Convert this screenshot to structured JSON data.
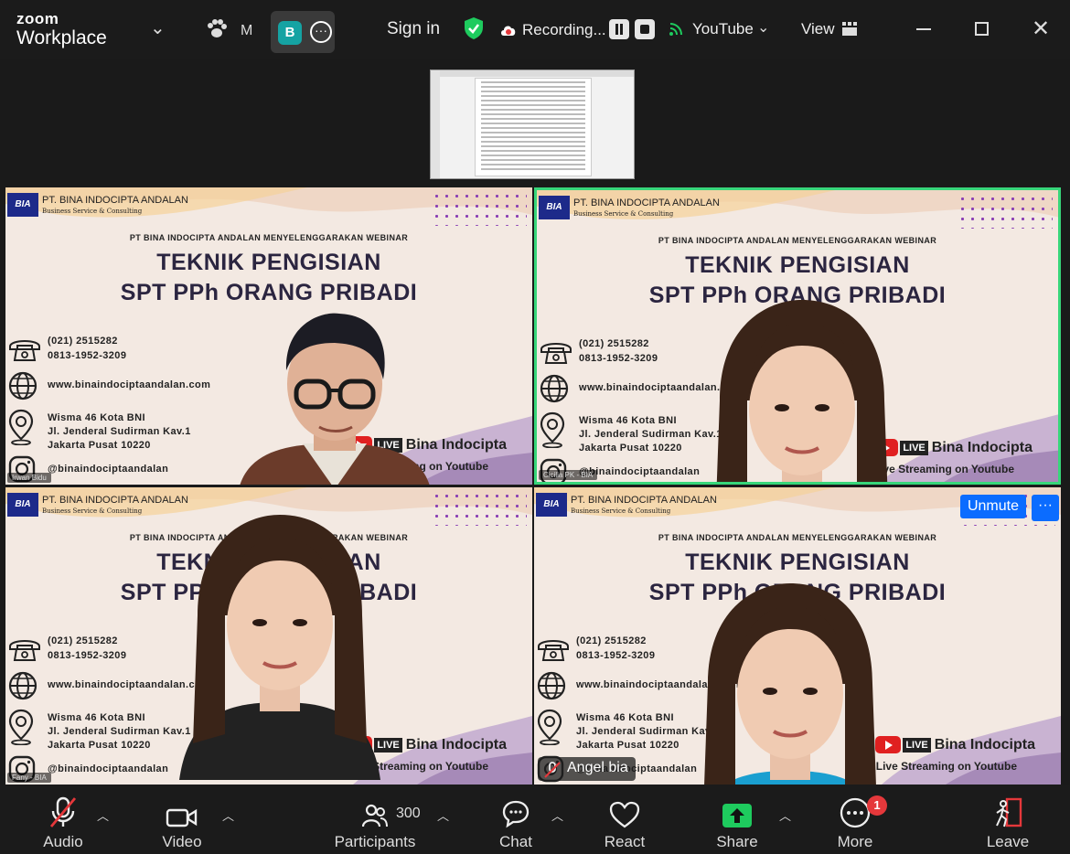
{
  "app": {
    "brand_top": "zoom",
    "brand_bottom": "Workplace"
  },
  "topbar": {
    "meeting_abbrev": "M",
    "avatar_letter": "B",
    "sign_in": "Sign in",
    "recording": "Recording...",
    "youtube": "YouTube",
    "view": "View"
  },
  "tiles": [
    {
      "company": "PT. BINA INDOCIPTA ANDALAN",
      "company_sub": "Business Service & Consulting",
      "logo": "BIA",
      "eyebrow": "PT BINA INDOCIPTA ANDALAN  MENYELENGGARAKAN WEBINAR",
      "title1": "TEKNIK PENGISIAN",
      "title2": "SPT PPh ORANG PRIBADI",
      "phone1": "(021) 2515282",
      "phone2": "0813-1952-3209",
      "web": "www.binaindociptaandalan.com",
      "addr1": "Wisma 46 Kota BNI",
      "addr2": "Jl. Jenderal Sudirman Kav.1",
      "addr3": "Jakarta Pusat 10220",
      "ig": "@binaindociptaandalan",
      "live_badge": "LIVE",
      "live_name": "Bina Indocipta",
      "live_sub": "Live Streaming on Youtube",
      "name": "Irwan Bidu"
    },
    {
      "company": "PT. BINA INDOCIPTA ANDALAN",
      "company_sub": "Business Service & Consulting",
      "logo": "BIA",
      "eyebrow": "PT BINA INDOCIPTA ANDALAN  MENYELENGGARAKAN WEBINAR",
      "title1": "TEKNIK PENGISIAN",
      "title2": "SPT PPh ORANG PRIBADI",
      "phone1": "(021) 2515282",
      "phone2": "0813-1952-3209",
      "web": "www.binaindociptaandalan.com",
      "addr1": "Wisma 46 Kota BNI",
      "addr2": "Jl. Jenderal Sudirman Kav.1",
      "addr3": "Jakarta Pusat 10220",
      "ig": "@binaindociptaandalan",
      "live_badge": "LIVE",
      "live_name": "Bina Indocipta",
      "live_sub": "Live Streaming on Youtube",
      "name": "Cicilia PK - BIA"
    },
    {
      "company": "PT. BINA INDOCIPTA ANDALAN",
      "company_sub": "Business Service & Consulting",
      "logo": "BIA",
      "eyebrow": "PT BINA INDOCIPTA ANDALAN  MENYELENGGARAKAN WEBINAR",
      "title1": "TEKNIK PENGISIAN",
      "title2": "SPT PPh ORANG PRIBADI",
      "phone1": "(021) 2515282",
      "phone2": "0813-1952-3209",
      "web": "www.binaindociptaandalan.com",
      "addr1": "Wisma 46 Kota BNI",
      "addr2": "Jl. Jenderal Sudirman Kav.1",
      "addr3": "Jakarta Pusat 10220",
      "ig": "@binaindociptaandalan",
      "live_badge": "LIVE",
      "live_name": "Bina Indocipta",
      "live_sub": "Live Streaming on Youtube",
      "name": "Fany - BIA"
    },
    {
      "company": "PT. BINA INDOCIPTA ANDALAN",
      "company_sub": "Business Service & Consulting",
      "logo": "BIA",
      "eyebrow": "PT BINA INDOCIPTA ANDALAN  MENYELENGGARAKAN WEBINAR",
      "title1": "TEKNIK PENGISIAN",
      "title2": "SPT PPh ORANG PRIBADI",
      "phone1": "(021) 2515282",
      "phone2": "0813-1952-3209",
      "web": "www.binaindociptaandalan.com",
      "addr1": "Wisma 46 Kota BNI",
      "addr2": "Jl. Jenderal Sudirman Kav.1",
      "addr3": "Jakarta Pusat 10220",
      "ig": "@binaindociptaandalan",
      "live_badge": "LIVE",
      "live_name": "Bina Indocipta",
      "live_sub": "Live Streaming on Youtube",
      "name": "Angel bia",
      "unmute": "Unmute",
      "more": "···"
    }
  ],
  "toolbar": {
    "audio": "Audio",
    "video": "Video",
    "participants": "Participants",
    "participants_count": "300",
    "chat": "Chat",
    "react": "React",
    "share": "Share",
    "more": "More",
    "more_badge": "1",
    "leave": "Leave"
  },
  "colors": {
    "accent": "#0b6cff",
    "active_speaker": "#37d67a",
    "share_green": "#1ecb5e",
    "badge_red": "#e5383b"
  }
}
